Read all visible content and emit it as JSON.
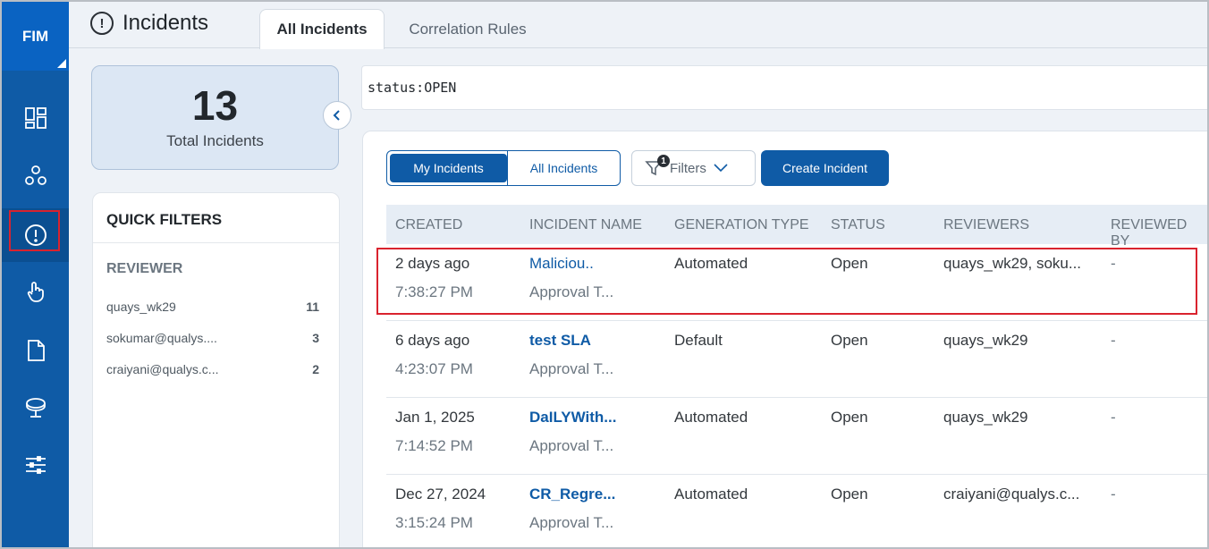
{
  "sidebar": {
    "brand": "FIM",
    "items": [
      {
        "icon": "dashboard-icon"
      },
      {
        "icon": "assets-icon"
      },
      {
        "icon": "incidents-icon",
        "active": true
      },
      {
        "icon": "touch-icon"
      },
      {
        "icon": "document-icon"
      },
      {
        "icon": "sensor-icon"
      },
      {
        "icon": "settings-sliders-icon"
      }
    ]
  },
  "header": {
    "title": "Incidents",
    "tabs": [
      {
        "label": "All Incidents",
        "active": true
      },
      {
        "label": "Correlation Rules",
        "active": false
      }
    ]
  },
  "summary": {
    "count": "13",
    "label": "Total Incidents"
  },
  "quick_filters": {
    "title": "QUICK FILTERS",
    "section": "REVIEWER",
    "reviewers": [
      {
        "name": "quays_wk29",
        "count": "11"
      },
      {
        "name": "sokumar@qualys....",
        "count": "3"
      },
      {
        "name": "craiyani@qualys.c...",
        "count": "2"
      }
    ]
  },
  "search": {
    "query": "status:OPEN"
  },
  "toolbar": {
    "my_incidents": "My Incidents",
    "all_incidents": "All Incidents",
    "filters": "Filters",
    "filter_count": "1",
    "create": "Create Incident"
  },
  "table": {
    "columns": [
      "CREATED",
      "INCIDENT NAME",
      "GENERATION TYPE",
      "STATUS",
      "REVIEWERS",
      "REVIEWED BY"
    ],
    "rows": [
      {
        "created_date": "2 days ago",
        "created_time": "7:38:27 PM",
        "name": "Maliciou..",
        "subtitle": "Approval T...",
        "generation": "Automated",
        "status": "Open",
        "reviewers": "quays_wk29, soku...",
        "reviewed_by": "-"
      },
      {
        "created_date": "6 days ago",
        "created_time": "4:23:07 PM",
        "name": "test SLA",
        "subtitle": "Approval T...",
        "generation": "Default",
        "status": "Open",
        "reviewers": "quays_wk29",
        "reviewed_by": "-"
      },
      {
        "created_date": "Jan 1, 2025",
        "created_time": "7:14:52 PM",
        "name": "DaILYWith...",
        "subtitle": "Approval T...",
        "generation": "Automated",
        "status": "Open",
        "reviewers": "quays_wk29",
        "reviewed_by": "-"
      },
      {
        "created_date": "Dec 27, 2024",
        "created_time": "3:15:24 PM",
        "name": "CR_Regre...",
        "subtitle": "Approval T...",
        "generation": "Automated",
        "status": "Open",
        "reviewers": "craiyani@qualys.c...",
        "reviewed_by": "-"
      }
    ]
  },
  "colors": {
    "sidebar": "#0f5ba6",
    "accent": "#0f5ba6",
    "highlight": "#d9232e"
  }
}
